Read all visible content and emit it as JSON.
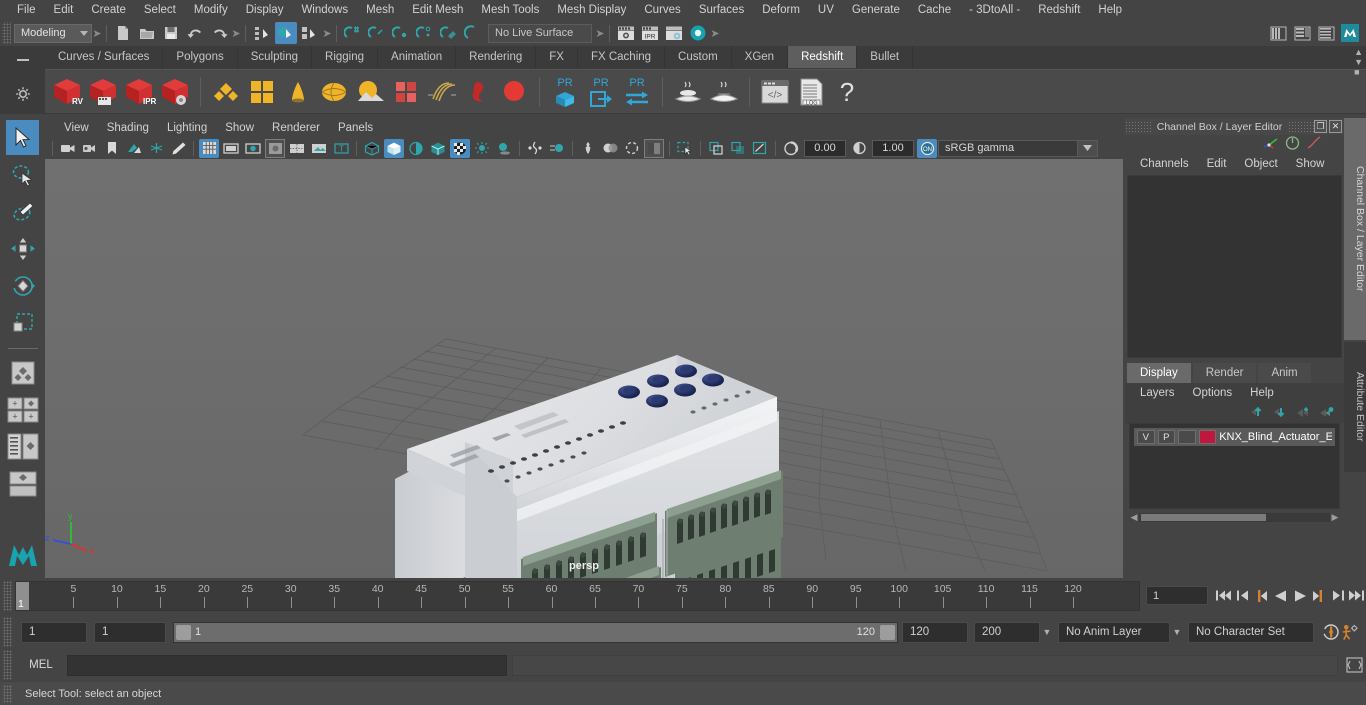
{
  "menubar": {
    "items": [
      "File",
      "Edit",
      "Create",
      "Select",
      "Modify",
      "Display",
      "Windows",
      "Mesh",
      "Edit Mesh",
      "Mesh Tools",
      "Mesh Display",
      "Curves",
      "Surfaces",
      "Deform",
      "UV",
      "Generate",
      "Cache",
      "- 3DtoAll -",
      "Redshift",
      "Help"
    ]
  },
  "statusline": {
    "menuset_value": "Modeling",
    "live_surface": "No Live Surface"
  },
  "shelf": {
    "tabs": [
      "Curves / Surfaces",
      "Polygons",
      "Sculpting",
      "Rigging",
      "Animation",
      "Rendering",
      "FX",
      "FX Caching",
      "Custom",
      "XGen",
      "Redshift",
      "Bullet"
    ],
    "active_tab": "Redshift",
    "icon_labels": [
      "RV",
      "IPR",
      "PR",
      "PR",
      "PR",
      ".LOG"
    ]
  },
  "viewport": {
    "menu": [
      "View",
      "Shading",
      "Lighting",
      "Show",
      "Renderer",
      "Panels"
    ],
    "exposure": "0.00",
    "gamma_value": "1.00",
    "color_profile": "sRGB gamma",
    "camera_label": "persp",
    "axis": {
      "x": "x",
      "y": "y",
      "z": "z"
    }
  },
  "rightpanel": {
    "title": "Channel Box / Layer Editor",
    "channelbox_menu": [
      "Channels",
      "Edit",
      "Object",
      "Show"
    ],
    "layer_tabs": [
      "Display",
      "Render",
      "Anim"
    ],
    "active_layer_tab": "Display",
    "layer_menu": [
      "Layers",
      "Options",
      "Help"
    ],
    "layers": [
      {
        "visible": "V",
        "playback": "P",
        "color": "#c0173c",
        "name": "KNX_Blind_Actuator_Ei"
      }
    ],
    "vertical_tabs": [
      "Channel Box / Layer Editor",
      "Attribute Editor"
    ]
  },
  "timeslider": {
    "ticks": [
      5,
      10,
      15,
      20,
      25,
      30,
      35,
      40,
      45,
      50,
      55,
      60,
      65,
      70,
      75,
      80,
      85,
      90,
      95,
      100,
      105,
      110,
      115,
      120
    ],
    "current_frame_marker": "1",
    "current_frame_field": "1"
  },
  "rangeslider": {
    "start_field": "1",
    "anim_start_field": "1",
    "range_start_label": "1",
    "range_end_label": "120",
    "playback_end": "120",
    "anim_end": "200",
    "anim_layer": "No Anim Layer",
    "character_set": "No Character Set"
  },
  "commandline": {
    "label": "MEL",
    "input_value": "",
    "output_value": ""
  },
  "helpline": {
    "text": "Select Tool: select an object"
  },
  "colors": {
    "accent_blue": "#4a8cbf",
    "teal": "#2fa6ab",
    "orange": "#d4812f",
    "layer_red": "#c0173c",
    "panel_bg": "#444444",
    "viewport_bg": "#6b6b6b"
  }
}
